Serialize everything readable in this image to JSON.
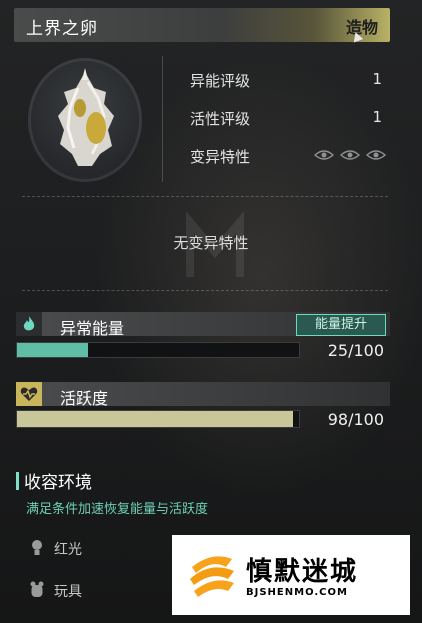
{
  "header": {
    "title": "上界之卵",
    "tag": "造物"
  },
  "stats": [
    {
      "label": "异能评级",
      "value": "1"
    },
    {
      "label": "活性评级",
      "value": "1"
    },
    {
      "label": "变异特性",
      "value": ""
    }
  ],
  "trait_text": "无变异特性",
  "energy": {
    "label": "异常能量",
    "button": "能量提升",
    "value_text": "25/100",
    "current": 25,
    "max": 100,
    "color": "#5fbfa6"
  },
  "activity": {
    "label": "活跃度",
    "value_text": "98/100",
    "current": 98,
    "max": 100,
    "color": "#c9c79a"
  },
  "environment": {
    "title": "收容环境",
    "description": "满足条件加速恢复能量与活跃度",
    "items": [
      {
        "label": "红光",
        "icon": "bulb-icon"
      },
      {
        "label": "玩具",
        "icon": "toy-icon"
      }
    ]
  },
  "watermark": {
    "name": "慎默迷城",
    "url": "BJSHENMO.COM"
  }
}
